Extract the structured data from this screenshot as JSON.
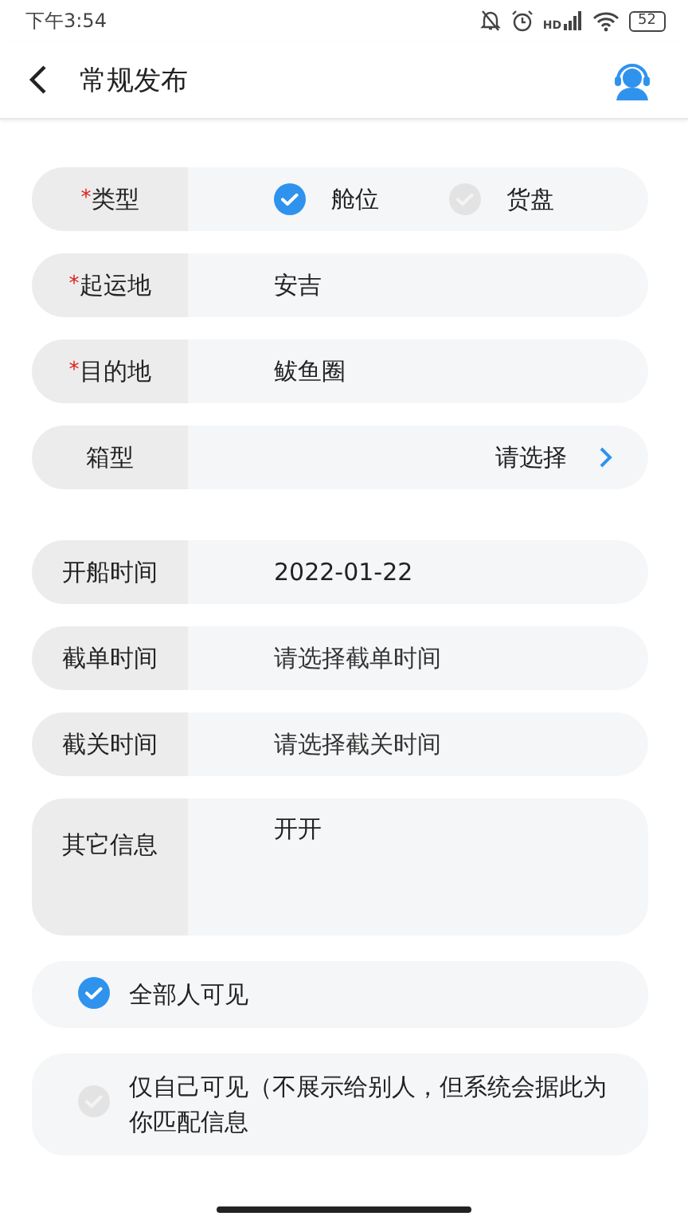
{
  "status_bar": {
    "time": "下午3:54",
    "network": "HD",
    "battery": "52"
  },
  "header": {
    "title": "常规发布"
  },
  "groups": [
    {
      "fields": [
        {
          "label": "类型",
          "marker": "*",
          "kind": "radio",
          "options": [
            {
              "label": "舱位",
              "selected": true
            },
            {
              "label": "货盘",
              "selected": false
            }
          ]
        },
        {
          "label": "起运地",
          "marker": "*",
          "kind": "text",
          "value": "安吉"
        },
        {
          "label": "目的地",
          "marker": "*",
          "kind": "text",
          "value": "鲅鱼圈"
        },
        {
          "label": "箱型",
          "kind": "select",
          "placeholder": "请选择"
        }
      ]
    },
    {
      "fields": [
        {
          "label": "开船时间",
          "kind": "text",
          "value": "2022-01-22"
        },
        {
          "label": "截单时间",
          "kind": "text",
          "placeholder": "请选择截单时间"
        },
        {
          "label": "截关时间",
          "kind": "text",
          "placeholder": "请选择截关时间"
        },
        {
          "label": "其它信息",
          "kind": "textarea",
          "value": "开开"
        }
      ]
    }
  ],
  "visibility": [
    {
      "label": "全部人可见",
      "selected": true
    },
    {
      "label": "仅自己可见（不展示给别人，但系统会据此为你匹配信息",
      "selected": false
    }
  ]
}
